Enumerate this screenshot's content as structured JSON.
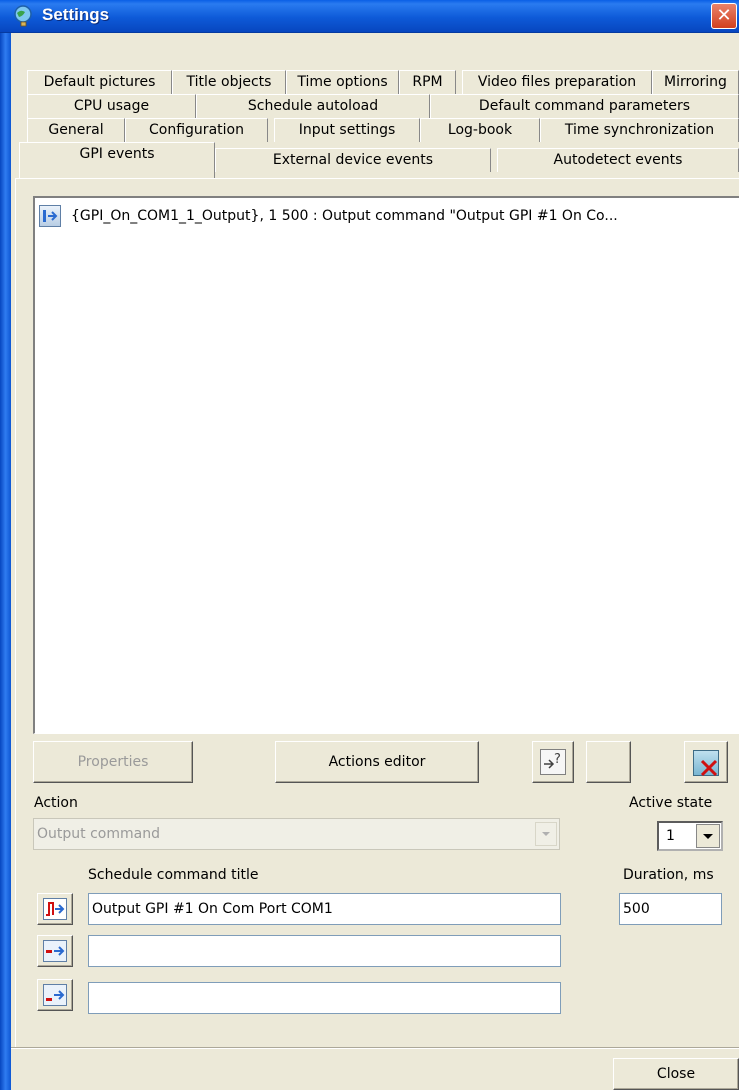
{
  "window": {
    "title": "Settings"
  },
  "tabs": {
    "row1": [
      "Default pictures",
      "Title objects",
      "Time options",
      "RPM",
      "Video files preparation",
      "Mirroring"
    ],
    "row2": [
      "CPU usage",
      "Schedule autoload",
      "Default command parameters"
    ],
    "row3": [
      "General",
      "Configuration",
      "Input settings",
      "Log-book",
      "Time synchronization"
    ],
    "row4": [
      "GPI events",
      "External device events",
      "Autodetect events"
    ],
    "active": "GPI events"
  },
  "event_list": {
    "items": [
      {
        "text": "{GPI_On_COM1_1_Output}, 1 500 : Output command \"Output GPI #1 On Co...",
        "icon": "output-command-icon"
      }
    ]
  },
  "buttons": {
    "properties": "Properties",
    "actions_editor": "Actions editor",
    "close": "Close"
  },
  "action": {
    "label": "Action",
    "value": "Output command"
  },
  "active_state": {
    "label": "Active state",
    "value": "1"
  },
  "schedule": {
    "title_label": "Schedule command title",
    "duration_label": "Duration, ms",
    "commands": [
      {
        "value": "Output GPI #1  On Com Port COM1",
        "icon": "pulse-command-icon"
      },
      {
        "value": "",
        "icon": "command-icon"
      },
      {
        "value": "",
        "icon": "command-icon"
      }
    ],
    "duration": "500"
  },
  "colors": {
    "titlebar": "#0a5fe6",
    "face": "#ece9d8",
    "close_red": "#d2401e"
  }
}
